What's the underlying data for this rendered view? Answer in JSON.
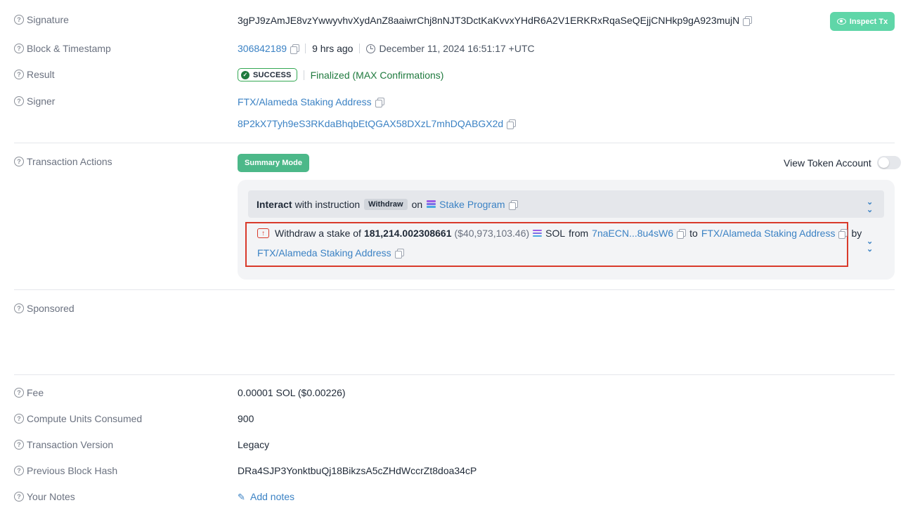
{
  "signature": {
    "label": "Signature",
    "value": "3gPJ9zAmJE8vzYwwyvhvXydAnZ8aaiwrChj8nNJT3DctKaKvvxYHdR6A2V1ERKRxRqaSeQEjjCNHkp9gA923mujN",
    "inspect_button": "Inspect Tx"
  },
  "block": {
    "label": "Block & Timestamp",
    "block_number": "306842189",
    "age": "9 hrs ago",
    "timestamp": "December 11, 2024 16:51:17 +UTC"
  },
  "result": {
    "label": "Result",
    "status": "SUCCESS",
    "finalized": "Finalized (MAX Confirmations)"
  },
  "signer": {
    "label": "Signer",
    "name": "FTX/Alameda Staking Address",
    "address": "8P2kX7Tyh9eS3RKdaBhqbEtQGAX58DXzL7mhDQABGX2d"
  },
  "actions": {
    "label": "Transaction Actions",
    "summary_button": "Summary Mode",
    "view_token_account": "View Token Account",
    "instruction": {
      "interact": "Interact",
      "with_instruction": "with instruction",
      "tag": "Withdraw",
      "on": "on",
      "program": "Stake Program"
    },
    "withdraw": {
      "prefix": "Withdraw a stake of",
      "amount": "181,214.002308661",
      "usd": "($40,973,103.46)",
      "token": "SOL",
      "from_word": "from",
      "from_addr": "7naECN...8u4sW6",
      "to_word": "to",
      "to_addr": "FTX/Alameda Staking Address",
      "by_word": "by",
      "by_addr": "FTX/Alameda Staking Address"
    }
  },
  "sponsored": {
    "label": "Sponsored"
  },
  "fee": {
    "label": "Fee",
    "value": "0.00001 SOL ($0.00226)"
  },
  "compute": {
    "label": "Compute Units Consumed",
    "value": "900"
  },
  "version": {
    "label": "Transaction Version",
    "value": "Legacy"
  },
  "prev_hash": {
    "label": "Previous Block Hash",
    "value": "DRa4SJP3YonktbuQj18BikzsA5cZHdWccrZt8doa34cP"
  },
  "notes": {
    "label": "Your Notes",
    "add": "Add notes"
  },
  "colors": {
    "link": "#3b82c4",
    "success_green": "#1f7a3e",
    "inspect_button": "#5fd6a8",
    "summary_button": "#4cb889",
    "highlight_border": "#d93a2b"
  }
}
